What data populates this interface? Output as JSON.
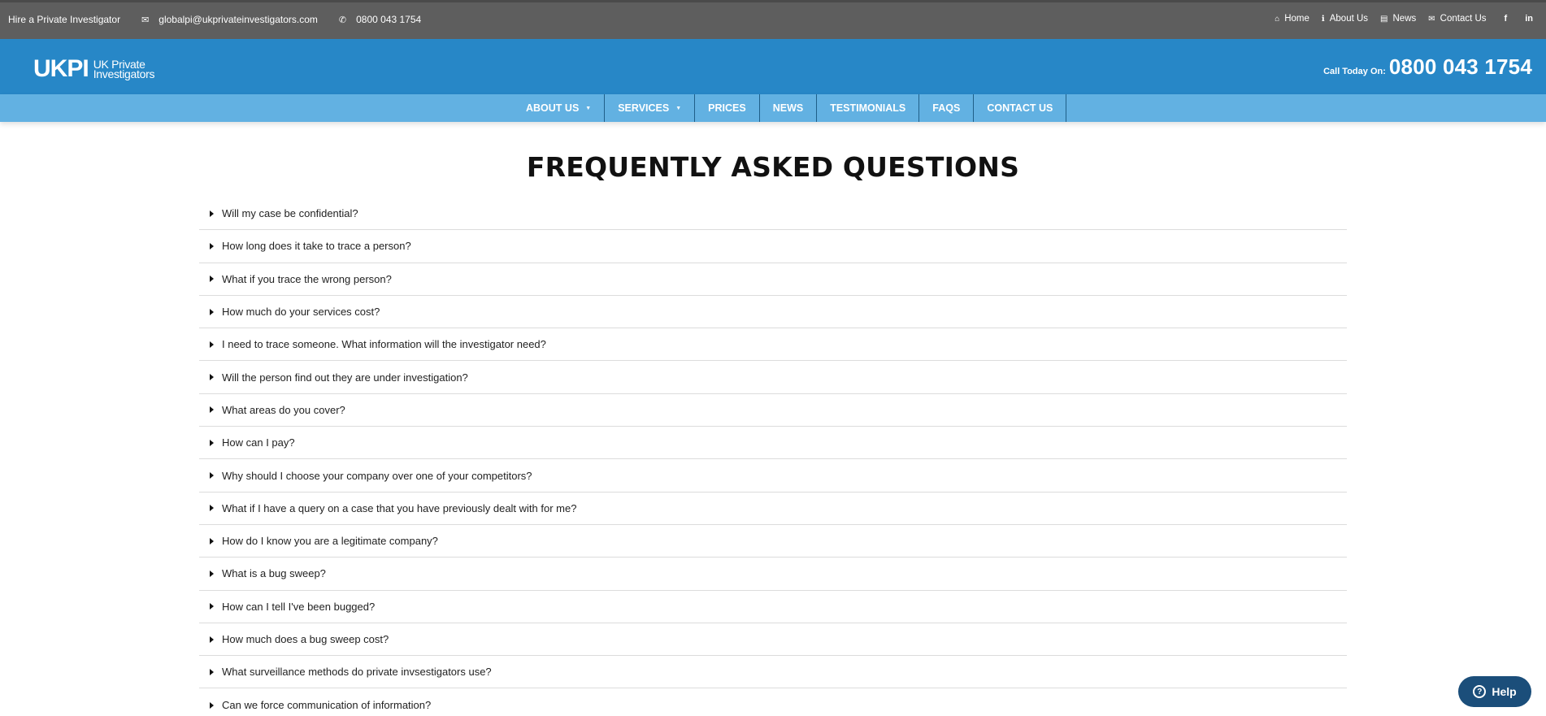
{
  "topbar": {
    "tagline": "Hire a Private Investigator",
    "email": "globalpi@ukprivateinvestigators.com",
    "phone": "0800 043 1754",
    "links": [
      {
        "icon": "home-icon",
        "glyph": "⌂",
        "label": "Home"
      },
      {
        "icon": "info-icon",
        "glyph": "ℹ",
        "label": "About Us"
      },
      {
        "icon": "news-icon",
        "glyph": "▤",
        "label": "News"
      },
      {
        "icon": "envelope-icon",
        "glyph": "✉",
        "label": "Contact Us"
      }
    ],
    "social": [
      {
        "icon": "facebook-icon",
        "glyph": "f"
      },
      {
        "icon": "linkedin-icon",
        "glyph": "in"
      }
    ]
  },
  "header": {
    "logo_mark": "UKPI",
    "logo_line1": "UK Private",
    "logo_line2": "Investigators",
    "call_label": "Call Today On:",
    "call_number": "0800 043 1754"
  },
  "nav": [
    {
      "label": "ABOUT US",
      "has_dropdown": true
    },
    {
      "label": "SERVICES",
      "has_dropdown": true
    },
    {
      "label": "PRICES",
      "has_dropdown": false
    },
    {
      "label": "NEWS",
      "has_dropdown": false
    },
    {
      "label": "TESTIMONIALS",
      "has_dropdown": false
    },
    {
      "label": "FAQS",
      "has_dropdown": false
    },
    {
      "label": "CONTACT US",
      "has_dropdown": false
    }
  ],
  "page": {
    "title": "FREQUENTLY ASKED QUESTIONS"
  },
  "faqs": [
    "Will my case be confidential?",
    "How long does it take to trace a person?",
    "What if you trace the wrong person?",
    "How much do your services cost?",
    "I need to trace someone. What information will the investigator need?",
    "Will the person find out they are under investigation?",
    "What areas do you cover?",
    "How can I pay?",
    "Why should I choose your company over one of your competitors?",
    "What if I have a query on a case that you have previously dealt with for me?",
    "How do I know you are a legitimate company?",
    "What is a bug sweep?",
    "How can I tell I've been bugged?",
    "How much does a bug sweep cost?",
    "What surveillance methods do private invsestigators use?",
    "Can we force communication of information?"
  ],
  "help": {
    "label": "Help",
    "glyph": "?"
  },
  "colors": {
    "topbar": "#5e5e5e",
    "header": "#2787c7",
    "nav": "#62b1e2",
    "help": "#1b4e7a"
  }
}
